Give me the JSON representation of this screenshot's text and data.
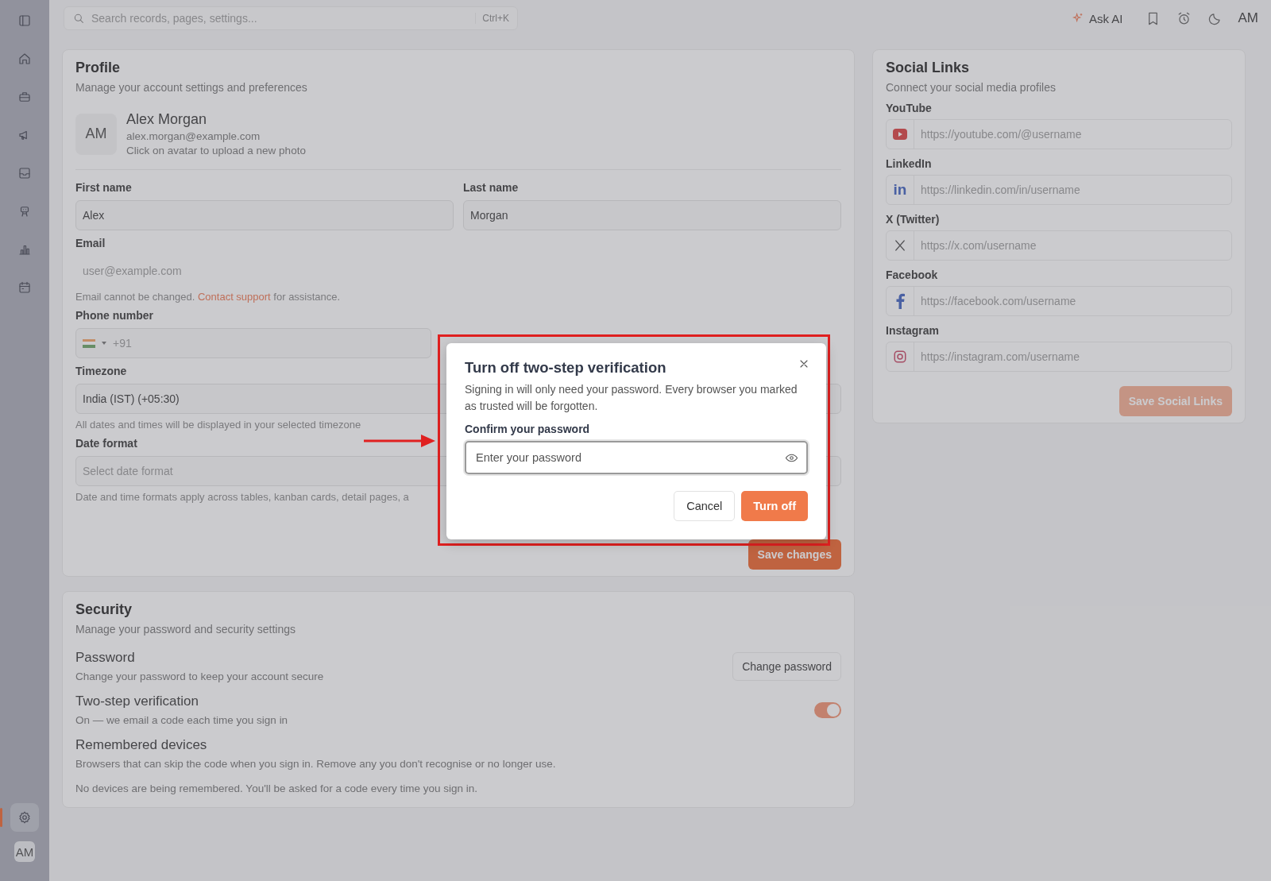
{
  "sidebar": {
    "items": [
      {
        "kind": "panel",
        "selected": false
      },
      {
        "kind": "home",
        "selected": false
      },
      {
        "kind": "briefcase",
        "selected": false
      },
      {
        "kind": "megaphone",
        "selected": false
      },
      {
        "kind": "inbox",
        "selected": false
      },
      {
        "kind": "robot",
        "selected": false
      },
      {
        "kind": "chart",
        "selected": false
      },
      {
        "kind": "calendar",
        "selected": false
      }
    ],
    "bottom_items": [
      {
        "kind": "settings",
        "selected": true
      }
    ],
    "avatar": "AM"
  },
  "topbar": {
    "search": {
      "placeholder": "Search records, pages, settings...",
      "shortcut": "Ctrl+K"
    },
    "ask_ai": "Ask AI",
    "avatar": "AM"
  },
  "profile": {
    "title": "Profile",
    "subtitle": "Manage your account settings and preferences",
    "avatar": "AM",
    "name": "Alex Morgan",
    "email": "alex.morgan@example.com",
    "avatar_hint": "Click on avatar to upload a new photo",
    "first_name": {
      "label": "First name",
      "value": "Alex"
    },
    "last_name": {
      "label": "Last name",
      "value": "Morgan"
    },
    "email_field": {
      "label": "Email",
      "placeholder": "user@example.com",
      "disabled": true
    },
    "email_note": {
      "before": "Email cannot be changed.",
      "link": "Contact support",
      "after": "for assistance."
    },
    "phone": {
      "label": "Phone number",
      "code": "+91"
    },
    "timezone": {
      "label": "Timezone",
      "value": "India (IST) (+05:30)",
      "hint": "All dates and times will be displayed in your selected timezone"
    },
    "date_format": {
      "label": "Date format",
      "placeholder": "Select date format",
      "hint": "Date and time formats apply across tables, kanban cards, detail pages, a"
    },
    "save": "Save changes"
  },
  "social": {
    "title": "Social Links",
    "subtitle": "Connect your social media profiles",
    "links": [
      {
        "kind": "youtube",
        "label": "YouTube",
        "placeholder": "https://youtube.com/@username"
      },
      {
        "kind": "linkedin",
        "icon_text": "in",
        "label": "LinkedIn",
        "placeholder": "https://linkedin.com/in/username"
      },
      {
        "kind": "x",
        "label": "X (Twitter)",
        "placeholder": "https://x.com/username"
      },
      {
        "kind": "facebook",
        "label": "Facebook",
        "placeholder": "https://facebook.com/username"
      },
      {
        "kind": "instagram",
        "label": "Instagram",
        "placeholder": "https://instagram.com/username"
      }
    ],
    "save": "Save Social Links"
  },
  "security": {
    "title": "Security",
    "subtitle": "Manage your password and security settings",
    "password": {
      "title": "Password",
      "text": "Change your password to keep your account secure",
      "button": "Change password"
    },
    "two_step": {
      "title": "Two-step verification",
      "text": "On — we email a code each time you sign in",
      "on": true
    },
    "devices": {
      "title": "Remembered devices",
      "text": "Browsers that can skip the code when you sign in. Remove any you don't recognise or no longer use.",
      "empty": "No devices are being remembered. You'll be asked for a code every time you sign in."
    }
  },
  "dialog": {
    "title": "Turn off two-step verification",
    "text": "Signing in will only need your password. Every browser you marked as trusted will be forgotten.",
    "field_label": "Confirm your password",
    "placeholder": "Enter your password",
    "cancel": "Cancel",
    "confirm": "Turn off"
  }
}
